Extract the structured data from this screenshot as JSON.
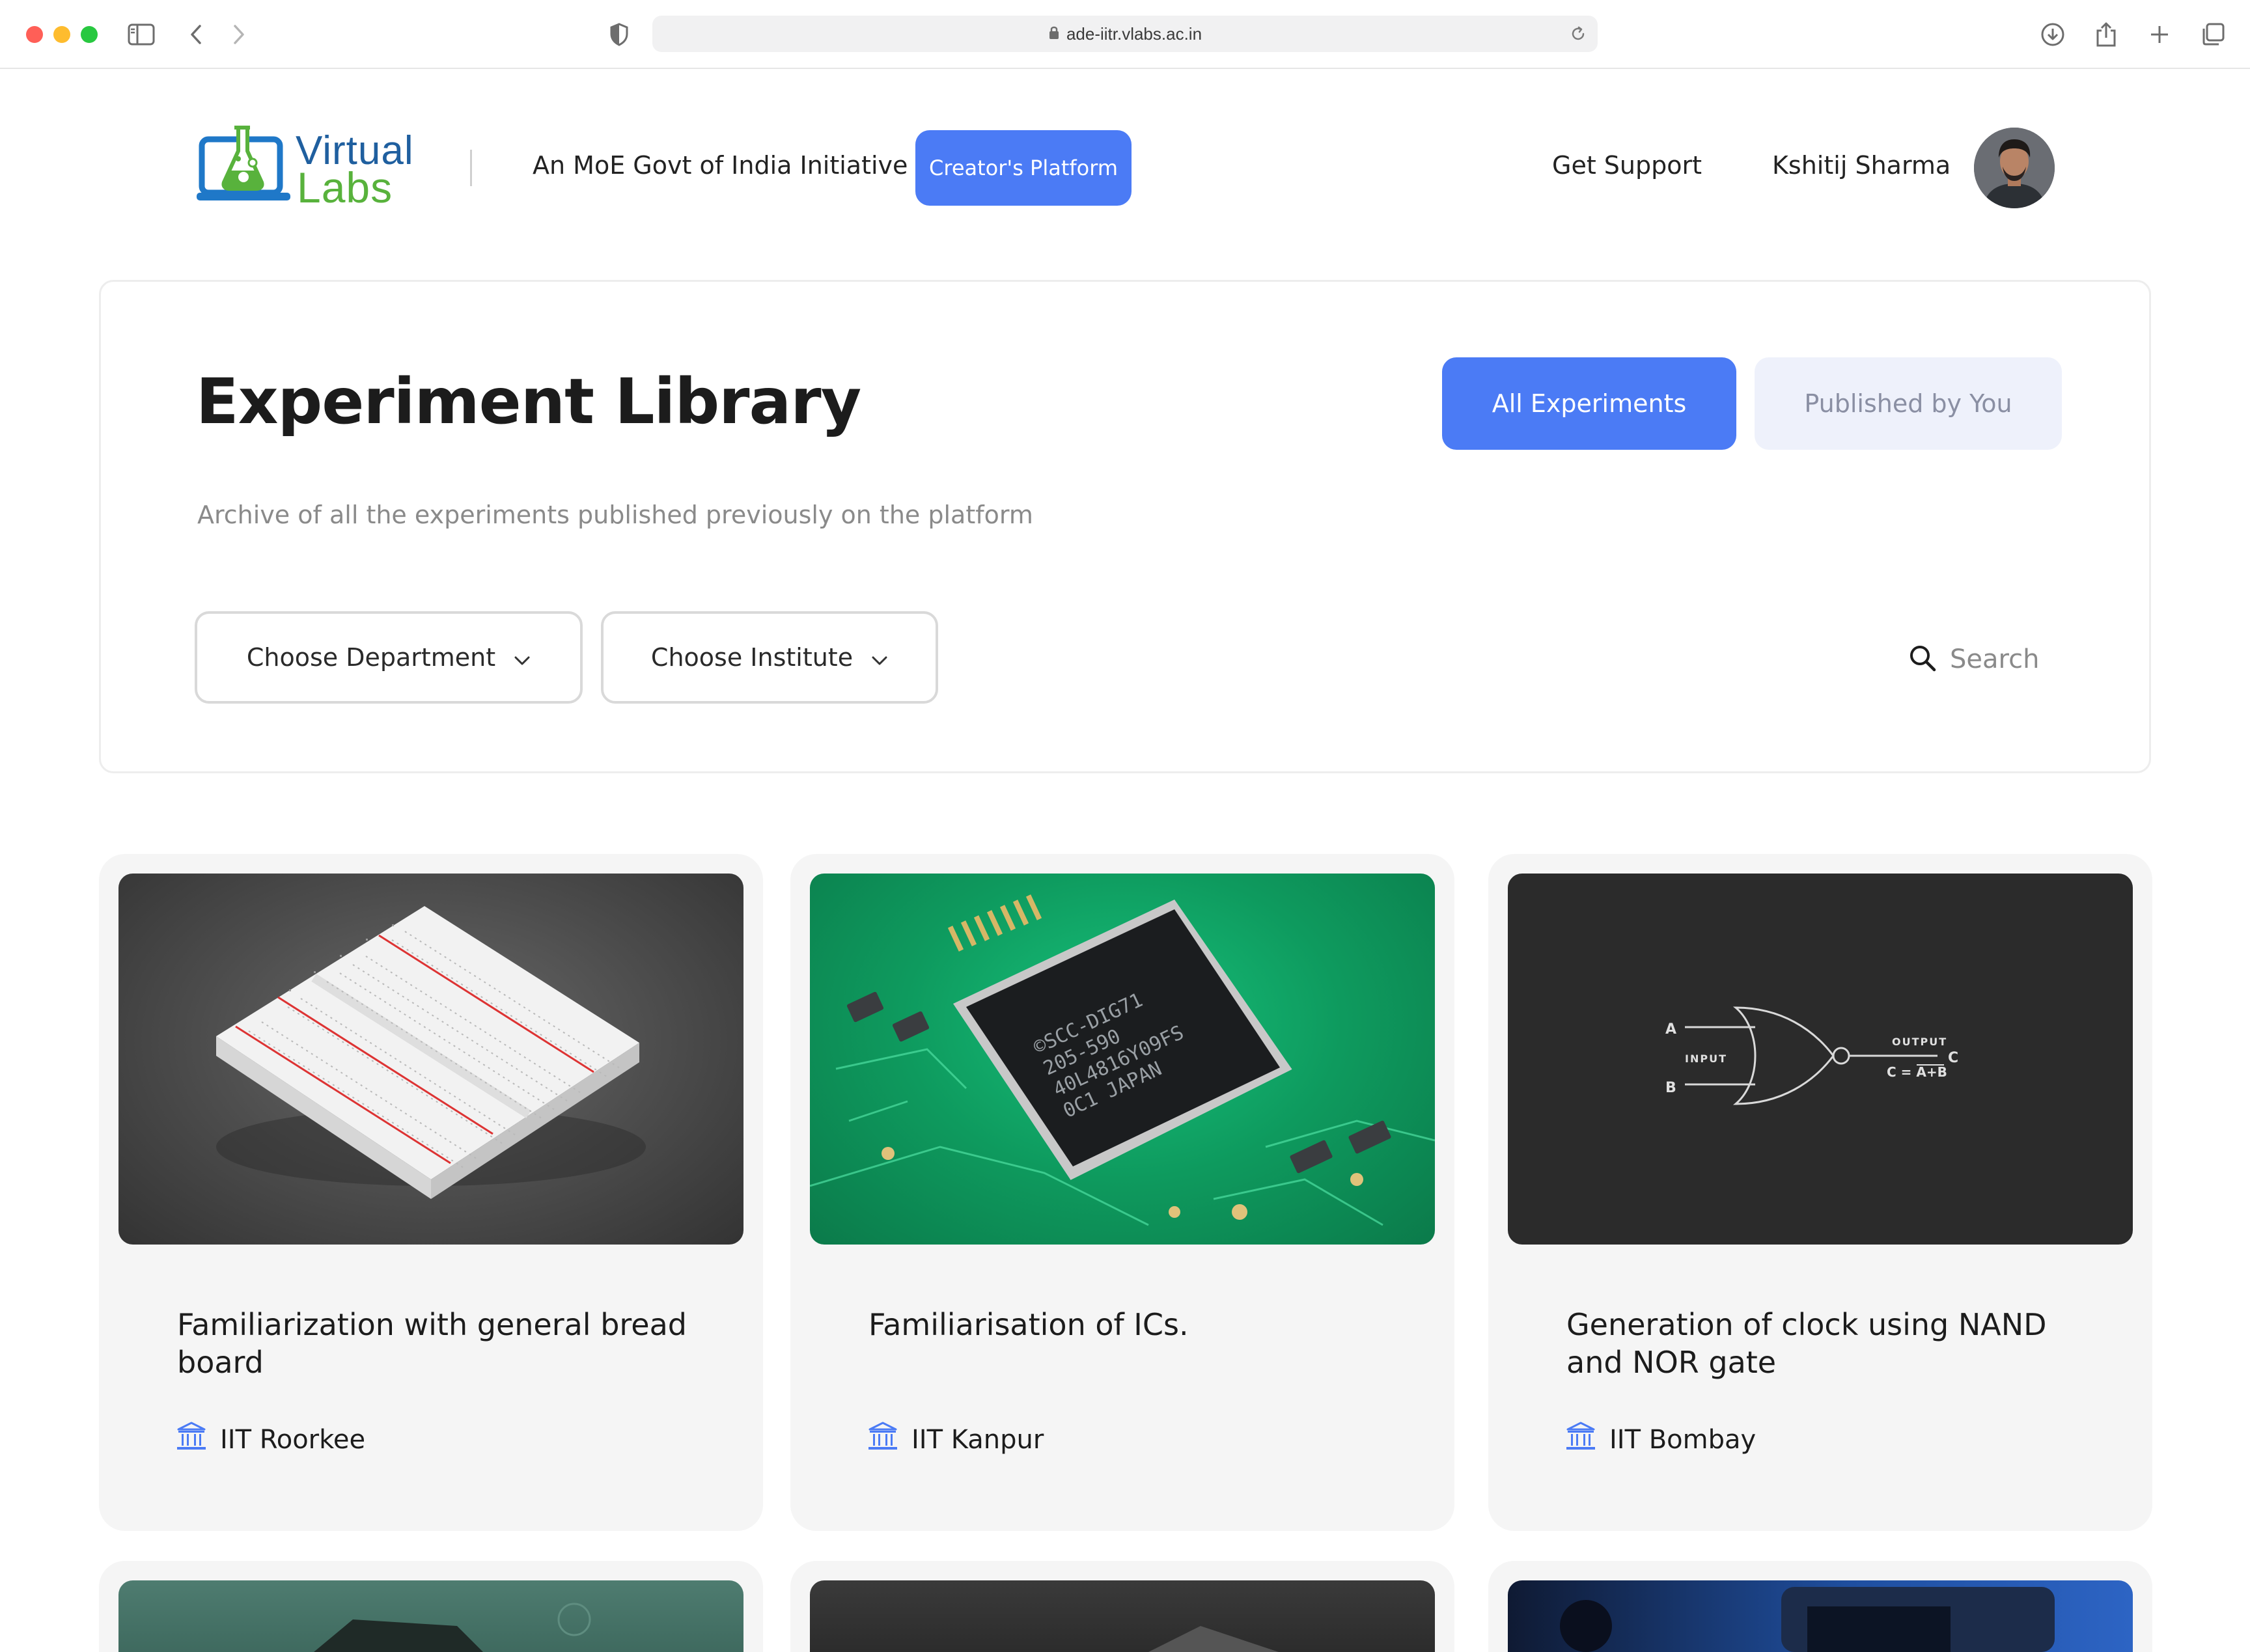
{
  "browser": {
    "url": "ade-iitr.vlabs.ac.in"
  },
  "header": {
    "logo_line1": "Virtual",
    "logo_line2": "Labs",
    "tagline": "An MoE Govt of India Initiative",
    "creator_button": "Creator's Platform",
    "support_link": "Get Support",
    "user_name": "Kshitij Sharma"
  },
  "library": {
    "title": "Experiment Library",
    "subtitle": "Archive of all the experiments published previously on the platform",
    "tabs": [
      {
        "label": "All Experiments",
        "active": true
      },
      {
        "label": "Published by You",
        "active": false
      }
    ],
    "filters": {
      "department": "Choose Department",
      "institute": "Choose Institute"
    },
    "search_placeholder": "Search"
  },
  "colors": {
    "accent": "#4b7bf5",
    "tab_inactive_bg": "#eef1fb",
    "card_bg": "#f5f5f5",
    "institute_icon": "#4b7bf5"
  },
  "cards": [
    {
      "title": "Familiarization with general bread board",
      "institute": "IIT Roorkee",
      "image_icon": "breadboard-image"
    },
    {
      "title": "Familiarisation of ICs.",
      "institute": "IIT Kanpur",
      "image_icon": "ic-chip-image"
    },
    {
      "title": "Generation of clock using NAND and NOR gate",
      "institute": "IIT Bombay",
      "image_icon": "nor-gate-diagram"
    }
  ],
  "nor_diagram": {
    "input_a": "A",
    "input_b": "B",
    "input_label": "INPUT",
    "output_label": "OUTPUT",
    "output_c": "C",
    "formula": "C = A+B"
  },
  "chip": {
    "line1": "©SCC-DIG71",
    "line2": "205-590",
    "line3": "40L4816Y09FS",
    "line4": "0C1  JAPAN"
  }
}
